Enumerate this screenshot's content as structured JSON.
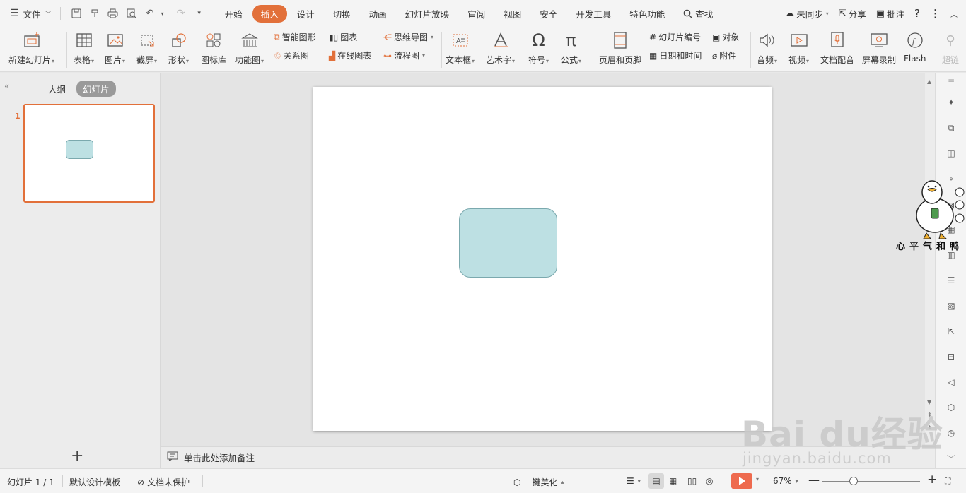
{
  "menubar": {
    "file_label": "文件",
    "tabs": [
      "开始",
      "插入",
      "设计",
      "切换",
      "动画",
      "幻灯片放映",
      "审阅",
      "视图",
      "安全",
      "开发工具",
      "特色功能"
    ],
    "active_tab": "插入",
    "search_label": "查找",
    "sync_label": "未同步",
    "share_label": "分享",
    "comment_label": "批注"
  },
  "ribbon": {
    "new_slide": "新建幻灯片",
    "table": "表格",
    "picture": "图片",
    "screenshot": "截屏",
    "shape": "形状",
    "icon_lib": "图标库",
    "func_chart": "功能图",
    "smart_art": "智能图形",
    "relation": "关系图",
    "chart": "图表",
    "online_chart": "在线图表",
    "mindmap": "思维导图",
    "flowchart": "流程图",
    "textbox": "文本框",
    "wordart": "艺术字",
    "symbol": "符号",
    "formula": "公式",
    "header_footer": "页眉和页脚",
    "slide_number": "幻灯片编号",
    "object": "对象",
    "datetime": "日期和时间",
    "attachment": "附件",
    "audio": "音频",
    "video": "视频",
    "doc_voice": "文档配音",
    "screen_rec": "屏幕录制",
    "flash": "Flash",
    "hyperlink": "超链"
  },
  "leftpane": {
    "outline_tab": "大纲",
    "slides_tab": "幻灯片",
    "slide_number": "1"
  },
  "notes": {
    "placeholder": "单击此处添加备注"
  },
  "statusbar": {
    "slide_info": "幻灯片 1 / 1",
    "template": "默认设计模板",
    "protect": "文档未保护",
    "beautify": "一键美化",
    "zoom": "67%"
  },
  "watermark": {
    "brand": "Bai du经验",
    "url": "jingyan.baidu.com"
  },
  "sticker": {
    "caption": "心平气和鸭"
  },
  "colors": {
    "accent": "#e2703a",
    "shape_fill": "#bde0e3",
    "shape_border": "#7ba9ae",
    "play": "#ee6a4e"
  }
}
